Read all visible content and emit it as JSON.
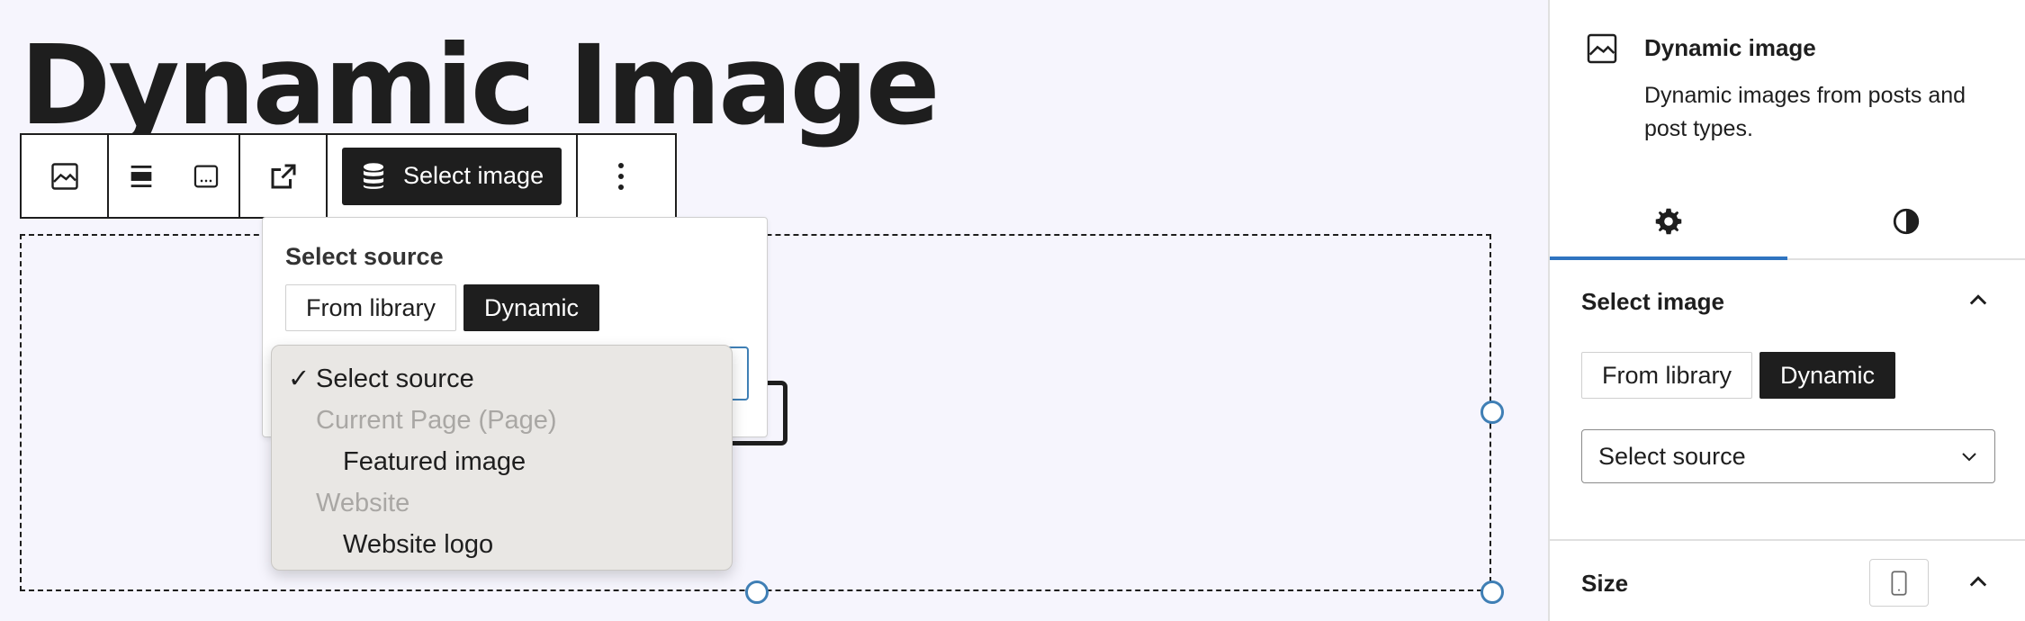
{
  "editor": {
    "page_title": "Dynamic Image"
  },
  "toolbar": {
    "select_image_label": "Select image",
    "icons": [
      "image-icon",
      "align-icon",
      "caption-icon",
      "external-link-icon",
      "database-icon",
      "more-vertical-icon"
    ]
  },
  "popover": {
    "heading": "Select source",
    "segment": {
      "from_library": "From library",
      "dynamic": "Dynamic",
      "selected": "Dynamic"
    }
  },
  "dropdown": {
    "selected_mark": "✓",
    "items": [
      {
        "label": "Select source",
        "kind": "option",
        "selected": true
      },
      {
        "label": "Current Page (Page)",
        "kind": "group"
      },
      {
        "label": "Featured image",
        "kind": "option"
      },
      {
        "label": "Website",
        "kind": "group"
      },
      {
        "label": "Website logo",
        "kind": "option"
      }
    ]
  },
  "sidebar": {
    "block": {
      "title": "Dynamic image",
      "description": "Dynamic images from posts and post types.",
      "icon": "image-icon"
    },
    "tabs": [
      {
        "icon": "gear-icon",
        "active": true
      },
      {
        "icon": "styles-icon",
        "active": false
      }
    ],
    "select_image_panel": {
      "title": "Select image",
      "from_library": "From library",
      "dynamic": "Dynamic",
      "source_value": "Select source"
    },
    "size_panel": {
      "title": "Size"
    }
  },
  "colors": {
    "canvas_bg": "#f6f5fd",
    "accent": "#2f74c0",
    "handle": "#3f7fb5",
    "dark": "#1e1e1e"
  }
}
